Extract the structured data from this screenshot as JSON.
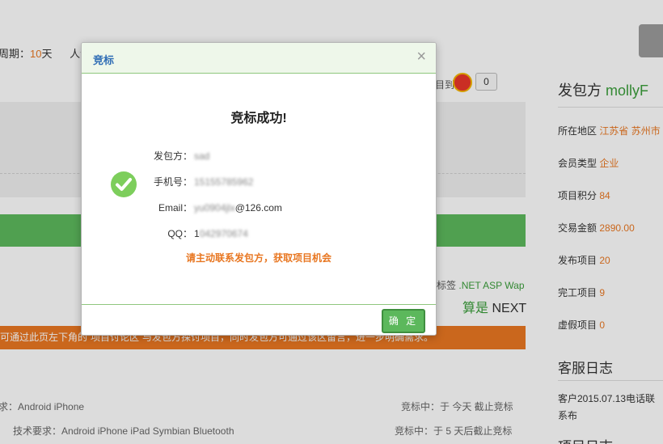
{
  "page": {
    "top_line": {
      "period_label": "周期：",
      "period_value": "10",
      "period_unit": "天",
      "popularity_label": "人气"
    },
    "share": {
      "label": "目到",
      "count": "0"
    },
    "tags": {
      "label": "标签",
      "values": ".NET ASP Wap"
    },
    "pager": {
      "prev": "算是",
      "next": "NEXT"
    },
    "orange_notice": "可通过此页左下角的“项目讨论区”与发包方探讨项目，同时发包方可通过该区留言，进一步明确需求。",
    "requirements": [
      {
        "label": "求：",
        "value": "Android iPhone",
        "status": "竞标中：于 今天 截止竞标"
      },
      {
        "label": "技术要求：",
        "value": "Android iPhone iPad Symbian Bluetooth",
        "status": "竞标中：于 5 天后截止竞标"
      }
    ]
  },
  "sidebar": {
    "title_prefix": "发包方",
    "title_name": "mollyF",
    "rows": [
      {
        "label": "所在地区",
        "value": "江苏省 苏州市"
      },
      {
        "label": "会员类型",
        "value": "企业"
      },
      {
        "label": "项目积分",
        "value": "84"
      },
      {
        "label": "交易金额",
        "value": "2890.00"
      },
      {
        "label": "发布项目",
        "value": "20"
      },
      {
        "label": "完工项目",
        "value": "9"
      },
      {
        "label": "虚假项目",
        "value": "0"
      }
    ],
    "service_log_title": "客服日志",
    "service_log_text": "客户2015.07.13电话联系布",
    "project_log_title": "项目日志"
  },
  "dialog": {
    "title": "竞标",
    "close_symbol": "×",
    "success_title": "竞标成功!",
    "fields": [
      {
        "label": "发包方：",
        "value": "sad",
        "blurred": true
      },
      {
        "label": "手机号：",
        "value": "15155785962",
        "blurred": true
      },
      {
        "label": "Email：",
        "value_blurred": "yu0904jlx",
        "value_clear": "@126.com"
      },
      {
        "label": "QQ：",
        "value_clear": "1",
        "value_blurred": "042970674"
      }
    ],
    "notice": "请主动联系发包方，获取项目机会",
    "ok_button": "确 定"
  },
  "colors": {
    "accent_green": "#5cb85c",
    "accent_orange": "#e87722",
    "title_blue": "#2f6db5"
  },
  "icons": [
    "close-icon",
    "check-circle-icon",
    "weibo-icon"
  ]
}
